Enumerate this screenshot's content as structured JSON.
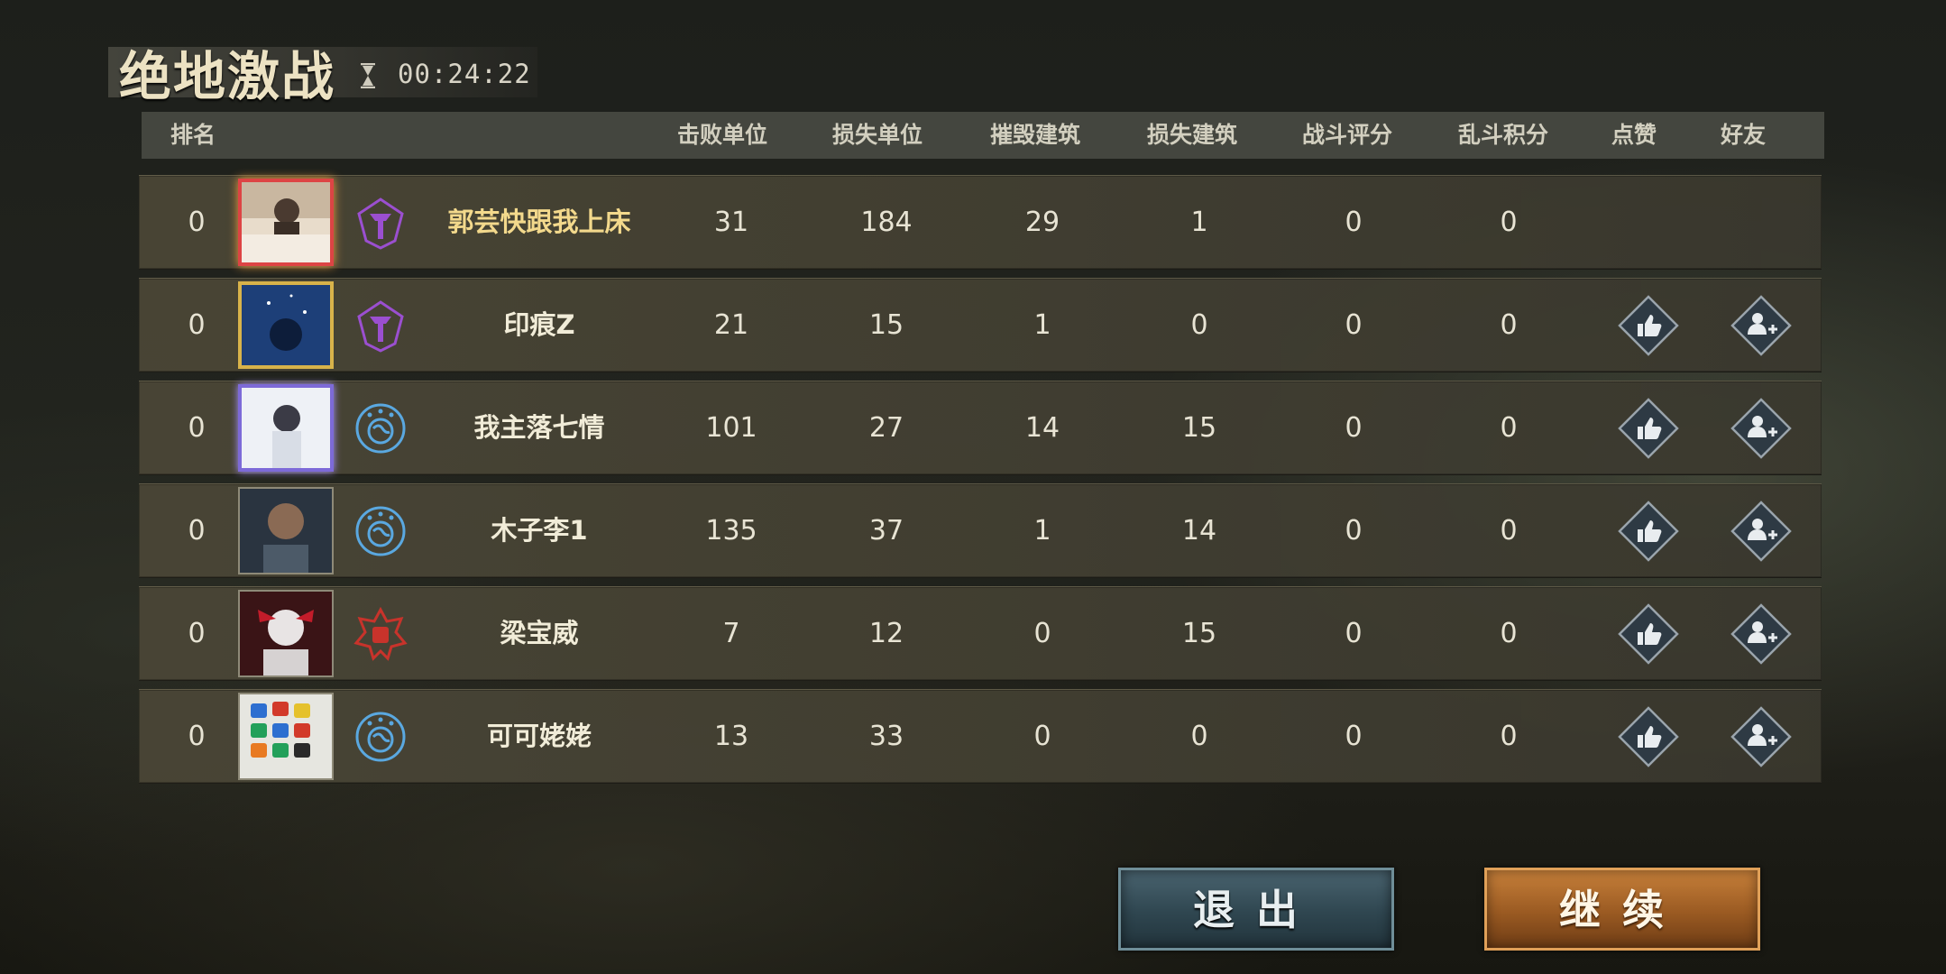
{
  "mode_title": "绝地激战",
  "timer": "00:24:22",
  "columns": {
    "rank": "排名",
    "defeated_units": "击败单位",
    "lost_units": "损失单位",
    "destroyed_buildings": "摧毁建筑",
    "lost_buildings": "损失建筑",
    "combat_score": "战斗评分",
    "brawl_points": "乱斗积分",
    "like": "点赞",
    "friend": "好友"
  },
  "players": [
    {
      "rank": "0",
      "name": "郭芸快跟我上床",
      "defeated_units": "31",
      "lost_units": "184",
      "destroyed_buildings": "29",
      "lost_buildings": "1",
      "combat_score": "0",
      "brawl_points": "0",
      "faction_icon": "purple-faction-icon",
      "is_self": true
    },
    {
      "rank": "0",
      "name": "印痕Z",
      "defeated_units": "21",
      "lost_units": "15",
      "destroyed_buildings": "1",
      "lost_buildings": "0",
      "combat_score": "0",
      "brawl_points": "0",
      "faction_icon": "purple-faction-icon",
      "is_self": false
    },
    {
      "rank": "0",
      "name": "我主落七情",
      "defeated_units": "101",
      "lost_units": "27",
      "destroyed_buildings": "14",
      "lost_buildings": "15",
      "combat_score": "0",
      "brawl_points": "0",
      "faction_icon": "globe-faction-icon",
      "is_self": false
    },
    {
      "rank": "0",
      "name": "木子李1",
      "defeated_units": "135",
      "lost_units": "37",
      "destroyed_buildings": "1",
      "lost_buildings": "14",
      "combat_score": "0",
      "brawl_points": "0",
      "faction_icon": "globe-faction-icon",
      "is_self": false
    },
    {
      "rank": "0",
      "name": "梁宝威",
      "defeated_units": "7",
      "lost_units": "12",
      "destroyed_buildings": "0",
      "lost_buildings": "15",
      "combat_score": "0",
      "brawl_points": "0",
      "faction_icon": "fist-faction-icon",
      "is_self": false
    },
    {
      "rank": "0",
      "name": "可可姥姥",
      "defeated_units": "13",
      "lost_units": "33",
      "destroyed_buildings": "0",
      "lost_buildings": "0",
      "combat_score": "0",
      "brawl_points": "0",
      "faction_icon": "globe-faction-icon",
      "is_self": false
    }
  ],
  "buttons": {
    "exit": "退出",
    "continue": "继续"
  },
  "colors": {
    "accent_gold": "#f3d98c",
    "faction_purple": "#9b4fd0",
    "faction_blue": "#5aa8e0",
    "faction_red": "#c8332b",
    "continue_orange": "#c7803a",
    "exit_teal": "#3a5560"
  }
}
